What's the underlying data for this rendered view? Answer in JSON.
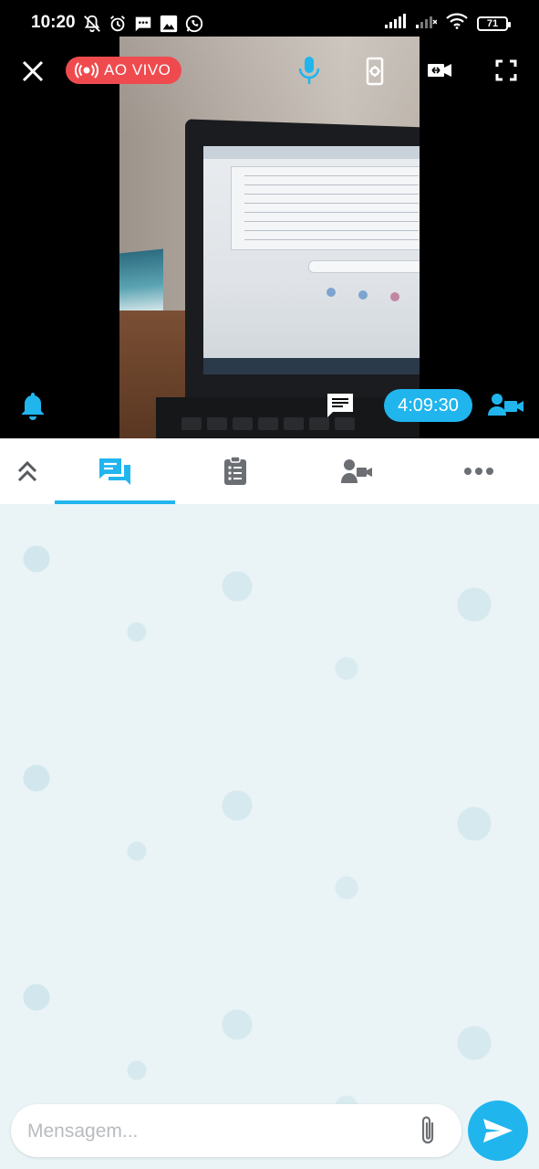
{
  "status_bar": {
    "time": "10:20",
    "battery_level": "71",
    "icons": [
      "notifications-muted-icon",
      "alarm-icon",
      "messages-icon",
      "image-icon",
      "whatsapp-icon"
    ],
    "system_icons": [
      "signal-icon",
      "signal-weak-icon",
      "wifi-icon",
      "battery-icon"
    ]
  },
  "video": {
    "live_label": "AO VIVO",
    "timer": "4:09:30",
    "controls": [
      "close-icon",
      "microphone-icon",
      "camera-settings-icon",
      "switch-camera-icon",
      "fullscreen-icon",
      "bell-icon",
      "chat-icon",
      "host-camera-icon"
    ]
  },
  "tabs": {
    "items": [
      "collapse",
      "chat",
      "notes",
      "participants",
      "more"
    ],
    "active": "chat"
  },
  "composer": {
    "placeholder": "Mensagem..."
  },
  "colors": {
    "accent": "#21b5ee",
    "live": "#ef4b4f",
    "tab_icon": "#6b6f73",
    "chat_background": "#eaf4f7"
  }
}
